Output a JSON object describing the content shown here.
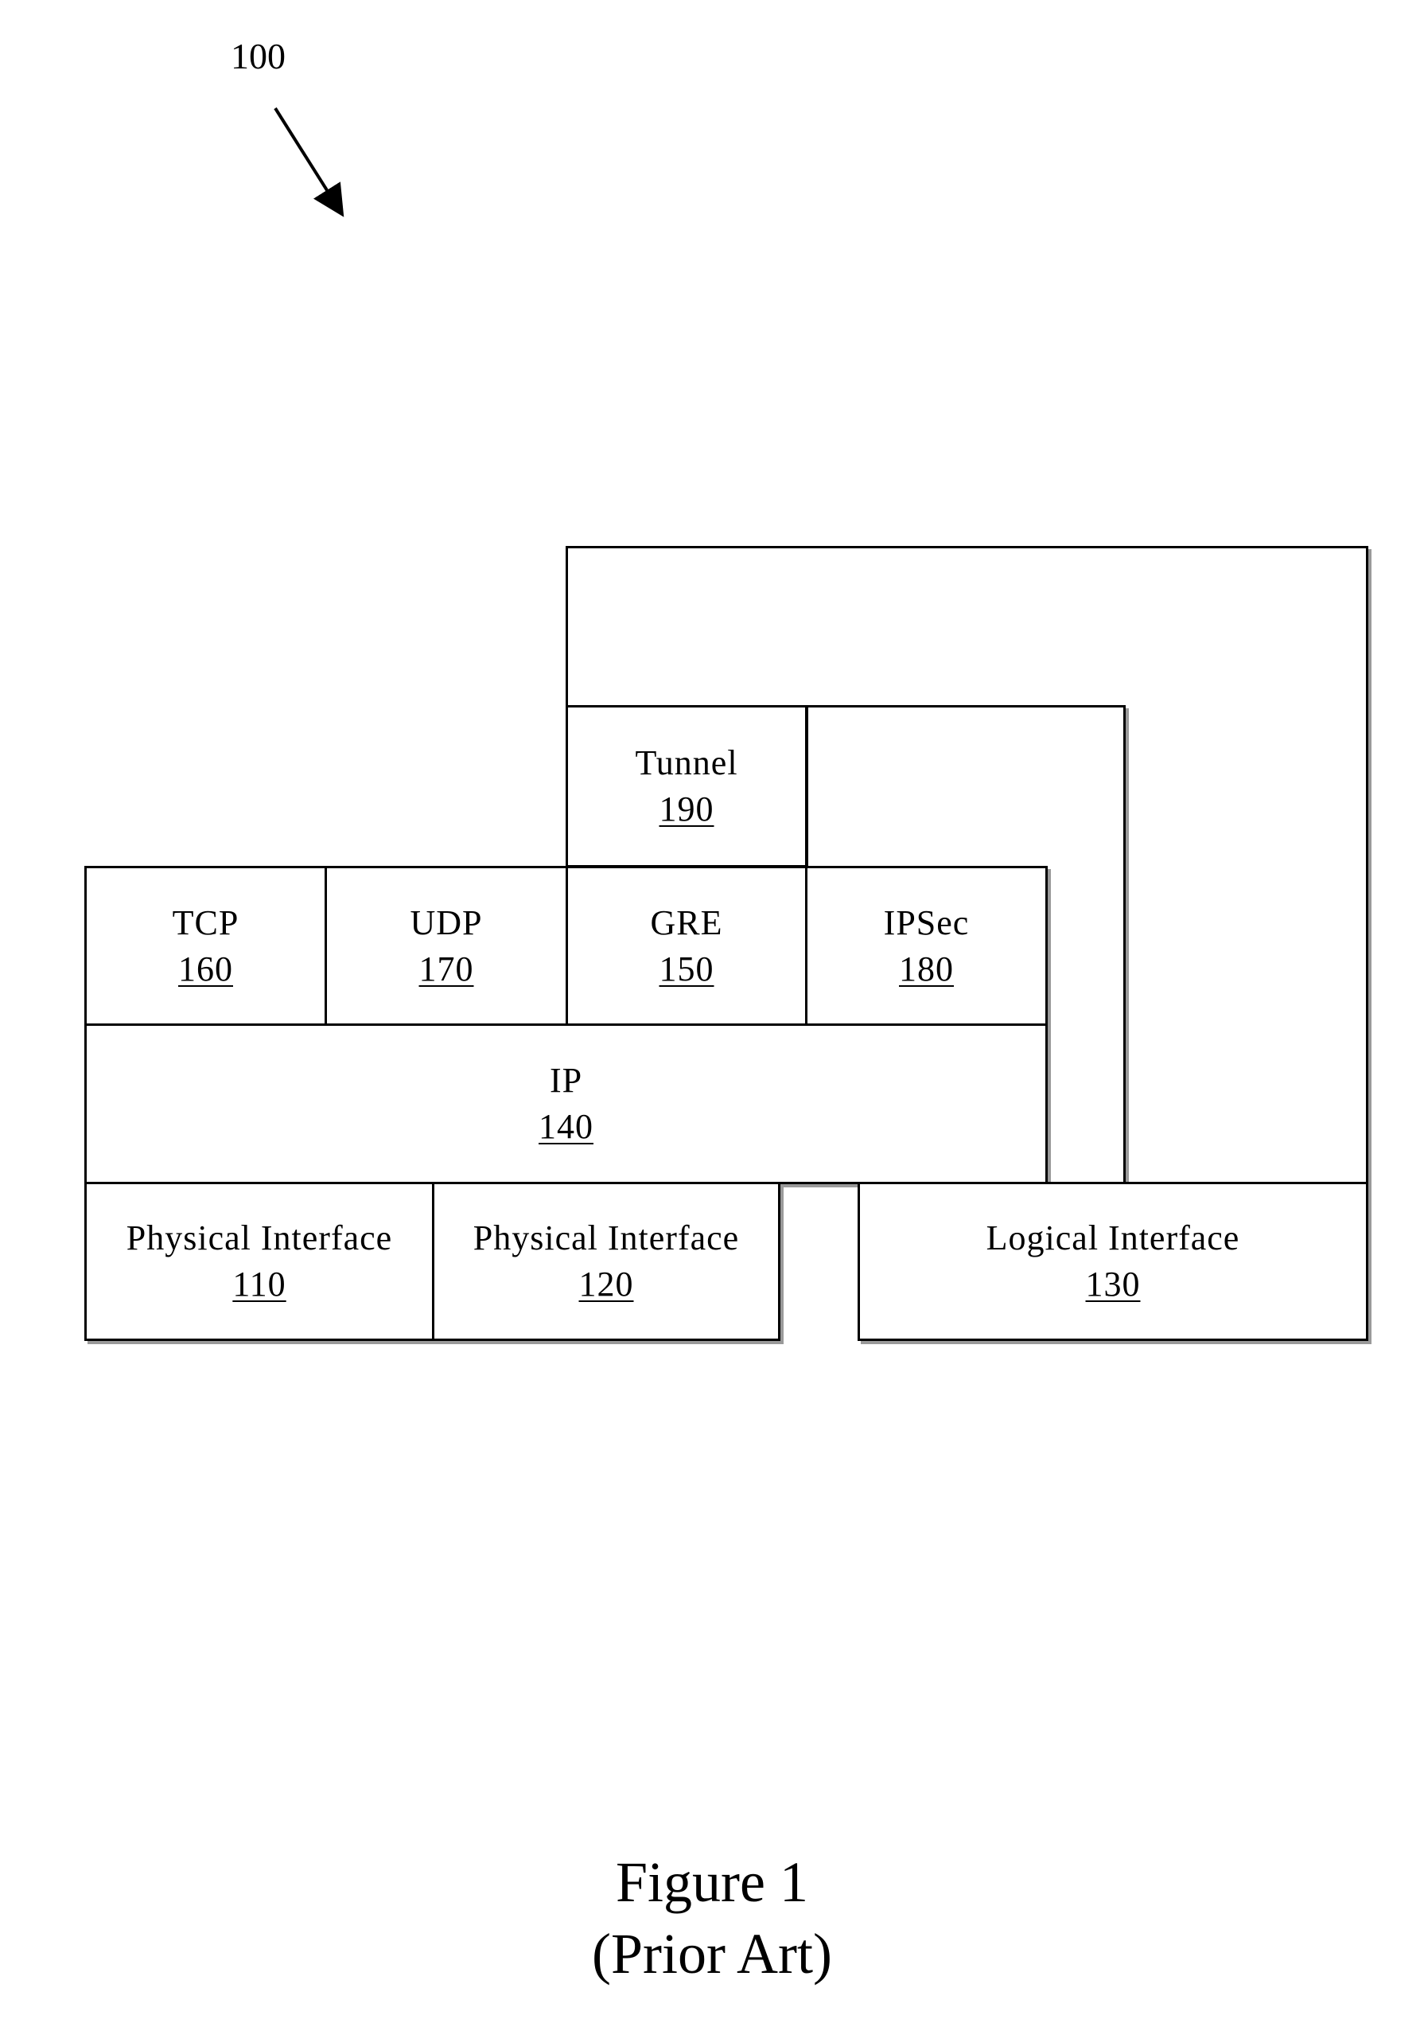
{
  "figure": {
    "reference_label": "100",
    "caption_title": "Figure 1",
    "caption_subtitle": "(Prior Art)"
  },
  "blocks": {
    "tunnel": {
      "name": "Tunnel",
      "ref": "190"
    },
    "tcp": {
      "name": "TCP",
      "ref": "160"
    },
    "udp": {
      "name": "UDP",
      "ref": "170"
    },
    "gre": {
      "name": "GRE",
      "ref": "150"
    },
    "ipsec": {
      "name": "IPSec",
      "ref": "180"
    },
    "ip": {
      "name": "IP",
      "ref": "140"
    },
    "phys1": {
      "name": "Physical Interface",
      "ref": "110"
    },
    "phys2": {
      "name": "Physical Interface",
      "ref": "120"
    },
    "logical": {
      "name": "Logical Interface",
      "ref": "130"
    }
  }
}
